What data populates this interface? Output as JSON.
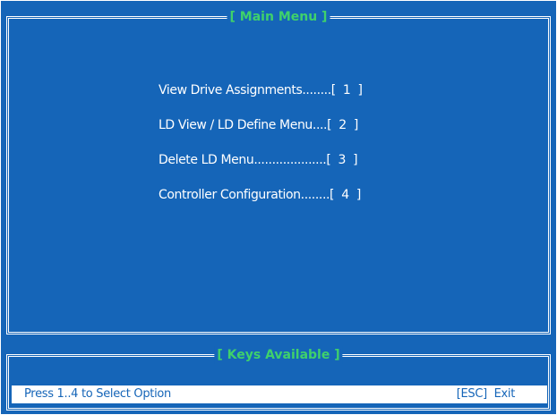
{
  "main_frame": {
    "title": "[ Main Menu ]"
  },
  "menu": {
    "items": [
      {
        "label": "View Drive Assignments........[  1  ]",
        "key": "1"
      },
      {
        "label": "LD View / LD Define Menu....[  2  ]",
        "key": "2"
      },
      {
        "label": "Delete LD Menu....................[  3  ]",
        "key": "3"
      },
      {
        "label": "Controller Configuration........[  4  ]",
        "key": "4"
      }
    ]
  },
  "keys_frame": {
    "title": "[ Keys Available ]"
  },
  "statusbar": {
    "hint": "Press 1..4 to Select Option",
    "exit_label": "[ESC]  Exit"
  },
  "colors": {
    "background": "#1565b8",
    "frame": "#ffffff",
    "title": "#3fd16b",
    "text": "#ffffff",
    "statusbar_bg": "#ffffff",
    "statusbar_text": "#1565b8"
  }
}
